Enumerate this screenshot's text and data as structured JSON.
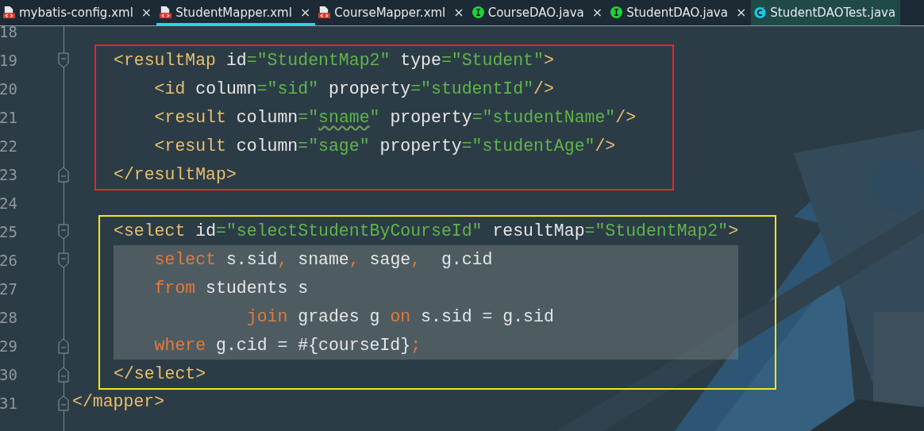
{
  "tabs": [
    {
      "label": "mybatis-config.xml",
      "kind": "xml",
      "close": "×",
      "selected": false,
      "hovered": false
    },
    {
      "label": "StudentMapper.xml",
      "kind": "xml",
      "close": "×",
      "selected": true,
      "hovered": false
    },
    {
      "label": "CourseMapper.xml",
      "kind": "xml",
      "close": "×",
      "selected": false,
      "hovered": false
    },
    {
      "label": "CourseDAO.java",
      "kind": "interface",
      "close": "×",
      "selected": false,
      "hovered": false
    },
    {
      "label": "StudentDAO.java",
      "kind": "interface",
      "close": "×",
      "selected": false,
      "hovered": false
    },
    {
      "label": "StudentDAOTest.java",
      "kind": "class",
      "selected": false,
      "hovered": true
    }
  ],
  "editor": {
    "sections": [
      {
        "kind": "plain",
        "lines": [
          {
            "number": "18",
            "kind": "plain"
          }
        ]
      },
      {
        "kind": "red_frame",
        "lines": [
          {
            "number": "19",
            "kind": "fold_start",
            "highlighted": false,
            "tokens": [
              {
                "text": "<resultMap",
                "kind": "tag"
              },
              {
                "text": " id",
                "kind": "attr"
              },
              {
                "text": "=\"StudentMap2\"",
                "kind": "str"
              },
              {
                "text": " type",
                "kind": "attr"
              },
              {
                "text": "=\"Student\"",
                "kind": "str"
              },
              {
                "text": ">",
                "kind": "tag"
              }
            ]
          },
          {
            "number": "20",
            "kind": "plain",
            "highlighted": false,
            "tokens": [
              {
                "text": "    <id",
                "kind": "tag"
              },
              {
                "text": " column",
                "kind": "attr"
              },
              {
                "text": "=\"sid\"",
                "kind": "str"
              },
              {
                "text": " property",
                "kind": "attr"
              },
              {
                "text": "=\"studentId\"",
                "kind": "str"
              },
              {
                "text": "/>",
                "kind": "tag"
              }
            ]
          },
          {
            "number": "21",
            "kind": "plain",
            "highlighted": false,
            "tokens": [
              {
                "text": "    <result",
                "kind": "tag"
              },
              {
                "text": " column",
                "kind": "attr"
              },
              {
                "text": "=\"",
                "kind": "str"
              },
              {
                "text": "sname",
                "kind": "str_warning"
              },
              {
                "text": "\"",
                "kind": "str"
              },
              {
                "text": " property",
                "kind": "attr"
              },
              {
                "text": "=\"studentName\"",
                "kind": "str"
              },
              {
                "text": "/>",
                "kind": "tag"
              }
            ]
          },
          {
            "number": "22",
            "kind": "plain",
            "highlighted": false,
            "tokens": [
              {
                "text": "    <result",
                "kind": "tag"
              },
              {
                "text": " column",
                "kind": "attr"
              },
              {
                "text": "=\"sage\"",
                "kind": "str"
              },
              {
                "text": " property",
                "kind": "attr"
              },
              {
                "text": "=\"studentAge\"",
                "kind": "str"
              },
              {
                "text": "/>",
                "kind": "tag"
              }
            ]
          },
          {
            "number": "23",
            "kind": "fold_end",
            "highlighted": false,
            "tokens": [
              {
                "text": "</resultMap>",
                "kind": "tag"
              }
            ]
          }
        ]
      },
      {
        "kind": "plain",
        "lines": [
          {
            "number": "24",
            "kind": "plain"
          }
        ]
      },
      {
        "kind": "yellow_frame",
        "lines": [
          {
            "number": "25",
            "kind": "fold_start",
            "highlighted": false,
            "tokens": [
              {
                "text": "<select",
                "kind": "tag"
              },
              {
                "text": " id",
                "kind": "attr"
              },
              {
                "text": "=\"selectStudentByCourseId\"",
                "kind": "str"
              },
              {
                "text": " resultMap",
                "kind": "attr"
              },
              {
                "text": "=\"StudentMap2\"",
                "kind": "str"
              },
              {
                "text": ">",
                "kind": "tag"
              }
            ]
          },
          {
            "number": "26",
            "kind": "fold_start",
            "highlighted": true,
            "tokens": [
              {
                "text": "    select",
                "kind": "kw"
              },
              {
                "text": " s.sid",
                "kind": "plain"
              },
              {
                "text": ",",
                "kind": "kw"
              },
              {
                "text": " sname",
                "kind": "plain"
              },
              {
                "text": ",",
                "kind": "kw"
              },
              {
                "text": " sage",
                "kind": "plain"
              },
              {
                "text": ",",
                "kind": "kw"
              },
              {
                "text": "  g.cid",
                "kind": "plain"
              }
            ]
          },
          {
            "number": "27",
            "kind": "plain",
            "highlighted": true,
            "tokens": [
              {
                "text": "    from",
                "kind": "kw"
              },
              {
                "text": " students s",
                "kind": "plain"
              }
            ]
          },
          {
            "number": "28",
            "kind": "plain",
            "highlighted": true,
            "tokens": [
              {
                "text": "             join",
                "kind": "kw"
              },
              {
                "text": " grades g ",
                "kind": "plain"
              },
              {
                "text": "on",
                "kind": "kw"
              },
              {
                "text": " s.sid = g.sid",
                "kind": "plain"
              }
            ]
          },
          {
            "number": "29",
            "kind": "fold_end",
            "highlighted": true,
            "tokens": [
              {
                "text": "    where",
                "kind": "kw"
              },
              {
                "text": " g.cid = #{courseId}",
                "kind": "plain"
              },
              {
                "text": ";",
                "kind": "kw"
              }
            ]
          },
          {
            "number": "30",
            "kind": "fold_end",
            "highlighted": false,
            "tokens": [
              {
                "text": "</select>",
                "kind": "tag"
              }
            ]
          }
        ]
      },
      {
        "kind": "plain",
        "lines": [
          {
            "number": "31",
            "kind": "fold_end",
            "highlighted": false,
            "tokens": [
              {
                "text": "</mapper>",
                "kind": "tag"
              }
            ]
          }
        ]
      }
    ]
  }
}
